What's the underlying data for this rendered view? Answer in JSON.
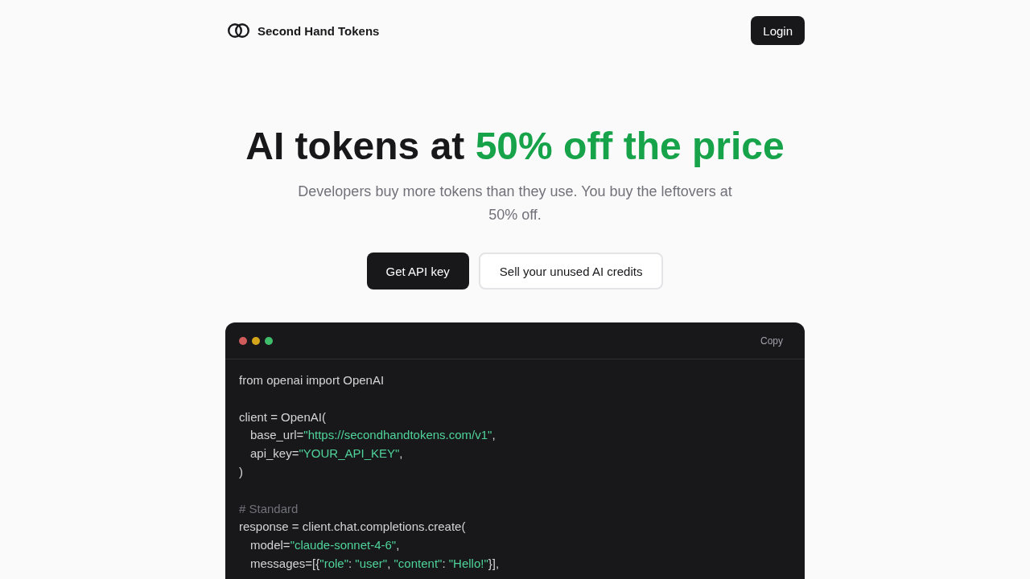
{
  "nav": {
    "brand": "Second Hand Tokens",
    "login": "Login"
  },
  "hero": {
    "title": "AI tokens at",
    "title_highlight": "50% off the price",
    "subtitle": "Developers buy more tokens than they use. You buy the leftovers at 50% off.",
    "buttons": [
      {
        "label": "Get API key",
        "kind": "primary"
      },
      {
        "label": "Sell your unused AI credits",
        "kind": "secondary"
      }
    ]
  },
  "code_window": {
    "dots": [
      {
        "color": "#cf5b5b"
      },
      {
        "color": "#d4a51a"
      },
      {
        "color": "#3fbd6b"
      }
    ],
    "copy": "Copy",
    "blocks": [
      {
        "lines": [
          {
            "parts": [
              {
                "kind": "code",
                "text": "from openai import OpenAI"
              }
            ]
          }
        ]
      },
      {
        "lines": [
          {
            "parts": [
              {
                "kind": "code",
                "text": "client = OpenAI("
              }
            ],
            "children": [
              {
                "parts": [
                  {
                    "kind": "code",
                    "text": "base_url="
                  },
                  {
                    "kind": "string",
                    "text": "\"https://secondhandtokens.com/v1\""
                  },
                  {
                    "kind": "code",
                    "text": ","
                  }
                ]
              },
              {
                "parts": [
                  {
                    "kind": "code",
                    "text": "api_key="
                  },
                  {
                    "kind": "string",
                    "text": "\"YOUR_API_KEY\""
                  },
                  {
                    "kind": "code",
                    "text": ","
                  }
                ]
              }
            ]
          },
          {
            "parts": [
              {
                "kind": "code",
                "text": ")"
              }
            ]
          }
        ]
      },
      {
        "lines": [
          {
            "parts": [
              {
                "kind": "comment",
                "text": "# Standard"
              }
            ]
          },
          {
            "parts": [
              {
                "kind": "code",
                "text": "response = client.chat.completions.create("
              }
            ],
            "children": [
              {
                "parts": [
                  {
                    "kind": "code",
                    "text": "model="
                  },
                  {
                    "kind": "string",
                    "text": "\"claude-sonnet-4-6\""
                  },
                  {
                    "kind": "code",
                    "text": ","
                  }
                ]
              },
              {
                "parts": [
                  {
                    "kind": "code",
                    "text": "messages=[{"
                  },
                  {
                    "kind": "string",
                    "text": "\"role\""
                  },
                  {
                    "kind": "code",
                    "text": ": "
                  },
                  {
                    "kind": "string",
                    "text": "\"user\""
                  },
                  {
                    "kind": "code",
                    "text": ", "
                  },
                  {
                    "kind": "string",
                    "text": "\"content\""
                  },
                  {
                    "kind": "code",
                    "text": ": "
                  },
                  {
                    "kind": "string",
                    "text": "\"Hello!\""
                  },
                  {
                    "kind": "code",
                    "text": "}],"
                  }
                ]
              }
            ]
          }
        ]
      }
    ]
  }
}
